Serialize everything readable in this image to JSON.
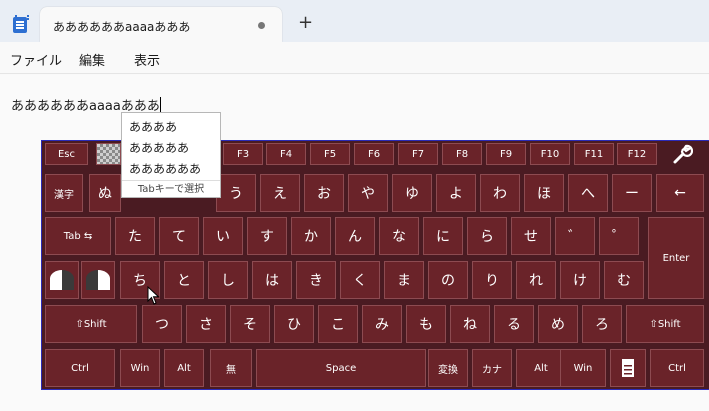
{
  "window": {
    "tab_title": "ああああああaaaaあああ",
    "new_tab": "+"
  },
  "menu": [
    "ファイル",
    "編集",
    "表示"
  ],
  "editor": {
    "committed": "ああああああaaaa",
    "composing": "あああ"
  },
  "candidates": {
    "items": [
      "ああああ",
      "あああああ",
      "ああああああ"
    ],
    "hint": "Tabキーで選択"
  },
  "keyboard": {
    "row1": [
      "Esc",
      "",
      "",
      "F3",
      "F4",
      "F5",
      "F6",
      "F7",
      "F8",
      "F9",
      "F10",
      "F11",
      "F12"
    ],
    "row2": [
      "漢字",
      "ぬ",
      "",
      "",
      "う",
      "え",
      "お",
      "や",
      "ゆ",
      "よ",
      "わ",
      "ほ",
      "へ",
      "ー",
      "←"
    ],
    "row3": [
      "Tab ⇆",
      "た",
      "て",
      "い",
      "す",
      "か",
      "ん",
      "な",
      "に",
      "ら",
      "せ",
      "゛",
      "゜",
      "Enter"
    ],
    "row4": [
      "",
      "",
      "ち",
      "と",
      "し",
      "は",
      "き",
      "く",
      "ま",
      "の",
      "り",
      "れ",
      "け",
      "む"
    ],
    "row5": [
      "⇧Shift",
      "つ",
      "さ",
      "そ",
      "ひ",
      "こ",
      "み",
      "も",
      "ね",
      "る",
      "め",
      "ろ",
      "⇧Shift"
    ],
    "row6": [
      "Ctrl",
      "Win",
      "Alt",
      "無",
      "Space",
      "変換",
      "カナ",
      "Alt",
      "Win",
      "",
      "Ctrl"
    ]
  },
  "icons": {
    "settings": "wrench-icon",
    "app": "notepad-icon",
    "cursor": "mouse-pointer-icon"
  }
}
